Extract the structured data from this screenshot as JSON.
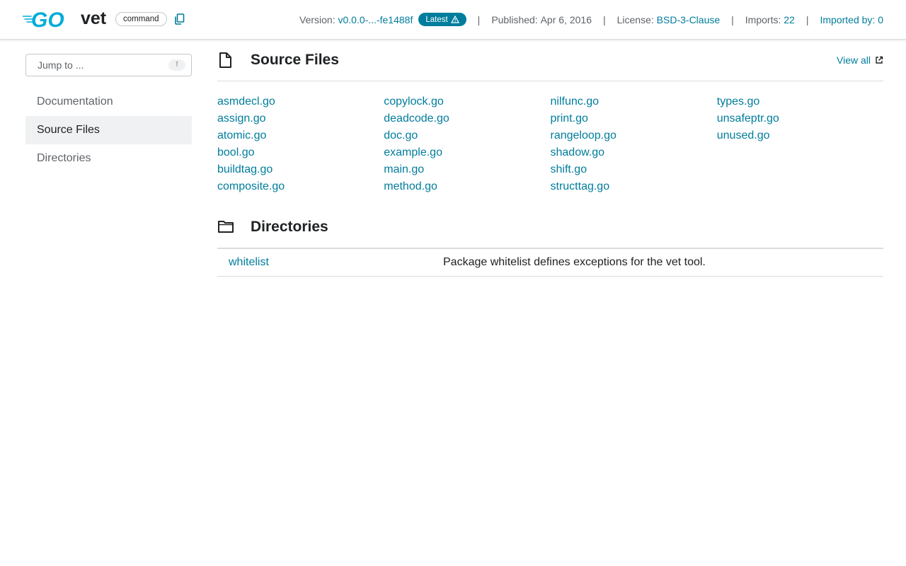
{
  "header": {
    "package_name": "vet",
    "kind_badge": "command",
    "version_label": "Version:",
    "version_value": "v0.0.0-...-fe1488f",
    "latest_label": "Latest",
    "published_label": "Published:",
    "published_value": "Apr 6, 2016",
    "license_label": "License:",
    "license_value": "BSD-3-Clause",
    "imports_label": "Imports:",
    "imports_value": "22",
    "imported_by_label": "Imported by:",
    "imported_by_value": "0",
    "separator": "|",
    "brand_color": "#00ADD8",
    "link_color": "#007d9c"
  },
  "sidebar": {
    "jump_placeholder": "Jump to ...",
    "jump_shortcut": "f",
    "items": [
      {
        "label": "Documentation",
        "active": false
      },
      {
        "label": "Source Files",
        "active": true
      },
      {
        "label": "Directories",
        "active": false
      }
    ]
  },
  "source_files": {
    "title": "Source Files",
    "view_all": "View all",
    "columns": [
      [
        "asmdecl.go",
        "assign.go",
        "atomic.go",
        "bool.go",
        "buildtag.go",
        "composite.go"
      ],
      [
        "copylock.go",
        "deadcode.go",
        "doc.go",
        "example.go",
        "main.go",
        "method.go"
      ],
      [
        "nilfunc.go",
        "print.go",
        "rangeloop.go",
        "shadow.go",
        "shift.go",
        "structtag.go"
      ],
      [
        "types.go",
        "unsafeptr.go",
        "unused.go"
      ]
    ]
  },
  "directories": {
    "title": "Directories",
    "rows": [
      {
        "name": "whitelist",
        "description": "Package whitelist defines exceptions for the vet tool."
      }
    ]
  },
  "icons": {
    "logo": "go-logo-icon",
    "copy": "copy-icon",
    "warning": "warning-icon",
    "file": "file-icon",
    "folder": "folder-icon",
    "external": "external-link-icon"
  }
}
